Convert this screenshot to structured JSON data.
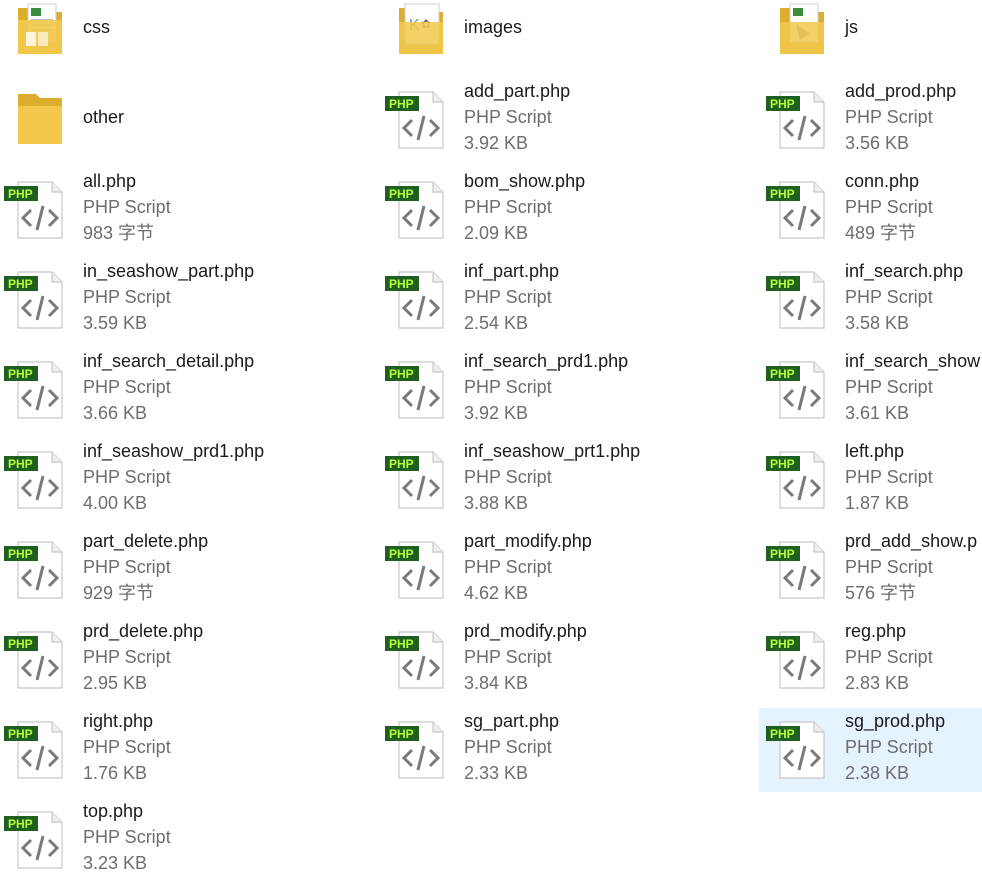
{
  "colors": {
    "selection_bg": "#e5f3ff",
    "php_badge_bg": "#1f5f1f",
    "php_badge_text": "#b7ff3c",
    "folder_yellow": "#f2c94c",
    "folder_dark": "#dcae2e",
    "name_text": "#1a1a1a",
    "meta_text": "#6d6d6d"
  },
  "folders": [
    {
      "name": "css",
      "icon": "folder-with-css-preview-icon"
    },
    {
      "name": "images",
      "icon": "folder-with-image-preview-icon"
    },
    {
      "name": "js",
      "icon": "folder-with-js-preview-icon"
    },
    {
      "name": "other",
      "icon": "empty-folder-icon"
    }
  ],
  "files": [
    {
      "name": "add_part.php",
      "type": "PHP Script",
      "size": "3.92 KB"
    },
    {
      "name": "add_prod.php",
      "type": "PHP Script",
      "size": "3.56 KB"
    },
    {
      "name": "all.php",
      "type": "PHP Script",
      "size": "983 字节"
    },
    {
      "name": "bom_show.php",
      "type": "PHP Script",
      "size": "2.09 KB"
    },
    {
      "name": "conn.php",
      "type": "PHP Script",
      "size": "489 字节"
    },
    {
      "name": "in_seashow_part.php",
      "type": "PHP Script",
      "size": "3.59 KB"
    },
    {
      "name": "inf_part.php",
      "type": "PHP Script",
      "size": "2.54 KB"
    },
    {
      "name": "inf_search.php",
      "type": "PHP Script",
      "size": "3.58 KB"
    },
    {
      "name": "inf_search_detail.php",
      "type": "PHP Script",
      "size": "3.66 KB"
    },
    {
      "name": "inf_search_prd1.php",
      "type": "PHP Script",
      "size": "3.92 KB"
    },
    {
      "name": "inf_search_show",
      "type": "PHP Script",
      "size": "3.61 KB"
    },
    {
      "name": "inf_seashow_prd1.php",
      "type": "PHP Script",
      "size": "4.00 KB"
    },
    {
      "name": "inf_seashow_prt1.php",
      "type": "PHP Script",
      "size": "3.88 KB"
    },
    {
      "name": "left.php",
      "type": "PHP Script",
      "size": "1.87 KB"
    },
    {
      "name": "part_delete.php",
      "type": "PHP Script",
      "size": "929 字节"
    },
    {
      "name": "part_modify.php",
      "type": "PHP Script",
      "size": "4.62 KB"
    },
    {
      "name": "prd_add_show.p",
      "type": "PHP Script",
      "size": "576 字节"
    },
    {
      "name": "prd_delete.php",
      "type": "PHP Script",
      "size": "2.95 KB"
    },
    {
      "name": "prd_modify.php",
      "type": "PHP Script",
      "size": "3.84 KB"
    },
    {
      "name": "reg.php",
      "type": "PHP Script",
      "size": "2.83 KB"
    },
    {
      "name": "right.php",
      "type": "PHP Script",
      "size": "1.76 KB"
    },
    {
      "name": "sg_part.php",
      "type": "PHP Script",
      "size": "2.33 KB"
    },
    {
      "name": "sg_prod.php",
      "type": "PHP Script",
      "size": "2.38 KB",
      "selected": true
    },
    {
      "name": "top.php",
      "type": "PHP Script",
      "size": "3.23 KB"
    }
  ],
  "php_badge_label": "PHP"
}
